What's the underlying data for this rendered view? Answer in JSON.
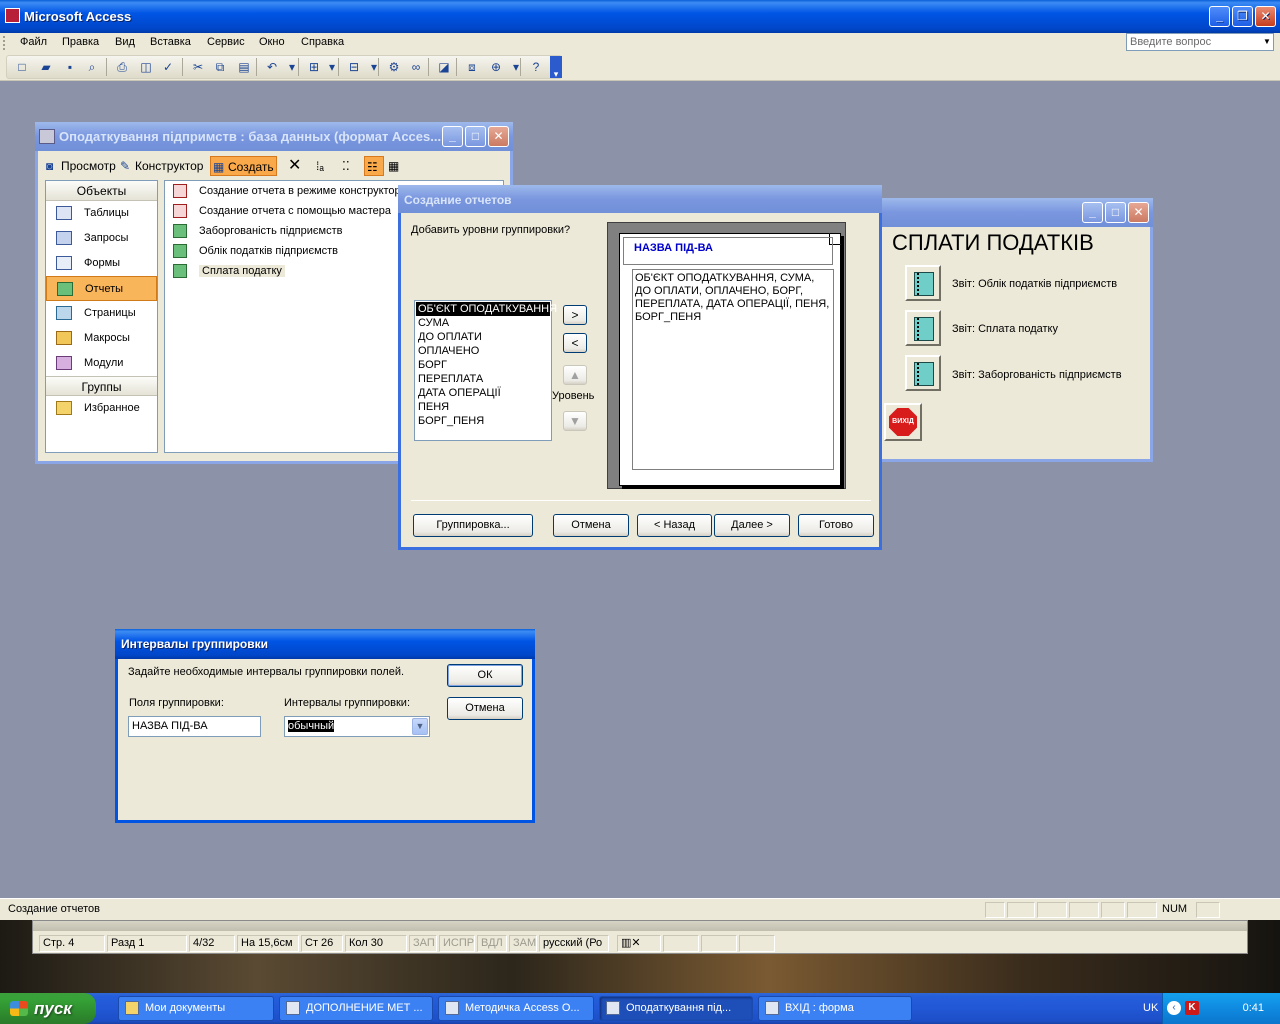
{
  "app": {
    "title": "Microsoft Access",
    "menu": [
      "Файл",
      "Правка",
      "Вид",
      "Вставка",
      "Сервис",
      "Окно",
      "Справка"
    ],
    "ask_placeholder": "Введите вопрос",
    "status_text": "Создание отчетов",
    "status_num": "NUM"
  },
  "db_window": {
    "title": "Оподаткування підпримств : база данных (формат Acces...",
    "tools": {
      "preview": "Просмотр",
      "design": "Конструктор",
      "create": "Создать"
    },
    "objects_header": "Объекты",
    "objects": [
      "Таблицы",
      "Запросы",
      "Формы",
      "Отчеты",
      "Страницы",
      "Макросы",
      "Модули"
    ],
    "selected_object": "Отчеты",
    "groups_header": "Группы",
    "groups": [
      "Избранное"
    ],
    "items": [
      "Создание отчета в режиме конструктора",
      "Создание отчета с помощью мастера",
      "Заборгованість підприємств",
      "Облік податків підприємств",
      "Сплата податку"
    ]
  },
  "form_window": {
    "heading": "СПЛАТИ ПОДАТКІВ",
    "buttons": [
      "Звіт: Облік податків підприємств",
      "Звіт: Сплата податку",
      "Звіт: Заборгованість підприємств"
    ],
    "exit_label": "ВИХІД"
  },
  "wizard": {
    "title": "Создание отчетов",
    "prompt": "Добавить уровни группировки?",
    "fields": [
      "ОБ'ЄКТ ОПОДАТКУВАННЯ",
      "СУМА",
      "ДО ОПЛАТИ",
      "ОПЛАЧЕНО",
      "БОРГ",
      "ПЕРЕПЛАТА",
      "ДАТА ОПЕРАЦІЇ",
      "ПЕНЯ",
      "БОРГ_ПЕНЯ"
    ],
    "selected_field": "ОБ'ЄКТ ОПОДАТКУВАННЯ",
    "add_btn": ">",
    "remove_btn": "<",
    "level_label": "Уровень",
    "group_field": "НАЗВА ПІД-ВА",
    "detail_fields": "ОБ'ЄКТ ОПОДАТКУВАННЯ, СУМА, ДО ОПЛАТИ, ОПЛАЧЕНО, БОРГ, ПЕРЕПЛАТА, ДАТА ОПЕРАЦІЇ, ПЕНЯ, БОРГ_ПЕНЯ",
    "buttons": {
      "grouping": "Группировка...",
      "cancel": "Отмена",
      "back": "< Назад",
      "next": "Далее >",
      "finish": "Готово"
    }
  },
  "intervals": {
    "title": "Интервалы группировки",
    "instruction": "Задайте необходимые интервалы группировки полей.",
    "fields_label": "Поля группировки:",
    "intervals_label": "Интервалы группировки:",
    "field_value": "НАЗВА ПІД-ВА",
    "interval_value": "обычный",
    "ok": "ОК",
    "cancel": "Отмена"
  },
  "word_status": {
    "page": "Стр. 4",
    "section": "Разд 1",
    "pages": "4/32",
    "at": "На 15,6см",
    "line": "Ст 26",
    "col": "Кол 30",
    "rec": "ЗАП",
    "trk": "ИСПР",
    "ext": "ВДЛ",
    "ovr": "ЗАМ",
    "lang": "русский (Ро"
  },
  "taskbar": {
    "start": "пуск",
    "tasks": [
      "Мои документы",
      "ДОПОЛНЕНИЕ МЕТ ...",
      "Методичка Access O...",
      "Оподаткування під...",
      "ВХІД : форма"
    ],
    "active_task": "Оподаткування під...",
    "lang": "UK",
    "clock": "0:41"
  }
}
